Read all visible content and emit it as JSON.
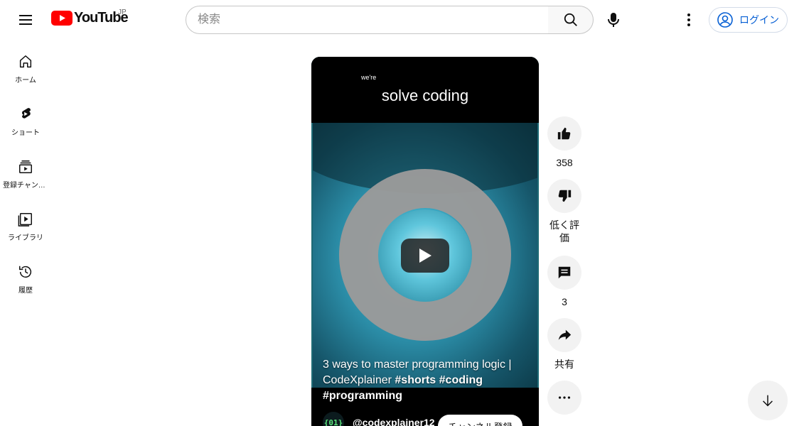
{
  "header": {
    "logo_text": "YouTube",
    "region": "JP",
    "search_placeholder": "検索",
    "login_label": "ログイン"
  },
  "sidebar": {
    "items": [
      {
        "label": "ホーム",
        "icon": "home-icon"
      },
      {
        "label": "ショート",
        "icon": "shorts-icon"
      },
      {
        "label": "登録チャンネル",
        "icon": "subscriptions-icon"
      },
      {
        "label": "ライブラリ",
        "icon": "library-icon"
      },
      {
        "label": "履歴",
        "icon": "history-icon"
      }
    ]
  },
  "video": {
    "caption_small": "we're",
    "caption_big": "solve coding",
    "title_plain": "3 ways to master programming logic | CodeXplainer ",
    "tag1": "#shorts",
    "tag2": "#coding",
    "tag3": "#programming",
    "channel_avatar_text": "{01}",
    "channel_name": "@codexplainer12",
    "subscribe_label": "チャンネル登録"
  },
  "actions": {
    "like_count": "358",
    "dislike_label": "低く評価",
    "comment_count": "3",
    "share_label": "共有"
  },
  "colors": {
    "brand_red": "#ff0000",
    "link_blue": "#065fd4"
  }
}
